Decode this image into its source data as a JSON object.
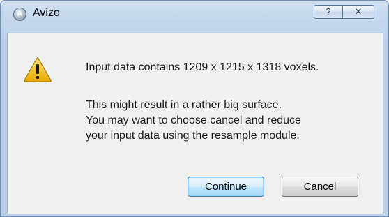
{
  "window": {
    "title": "Avizo",
    "app_icon_glyph": "A",
    "help_glyph": "?",
    "close_glyph": "✕"
  },
  "dialog": {
    "icon": "warning-icon",
    "line1": "Input data contains 1209 x 1215 x 1318 voxels.",
    "paragraph": [
      "This might result in a rather big surface.",
      "You may want to choose cancel and reduce",
      "your input data using the resample module."
    ],
    "buttons": {
      "continue_label": "Continue",
      "cancel_label": "Cancel"
    }
  },
  "colors": {
    "titlebar": "#c3d6ec",
    "content_bg": "#f0f0f0",
    "warning_fill": "#f5c518",
    "default_button_border": "#3c7fb1"
  }
}
